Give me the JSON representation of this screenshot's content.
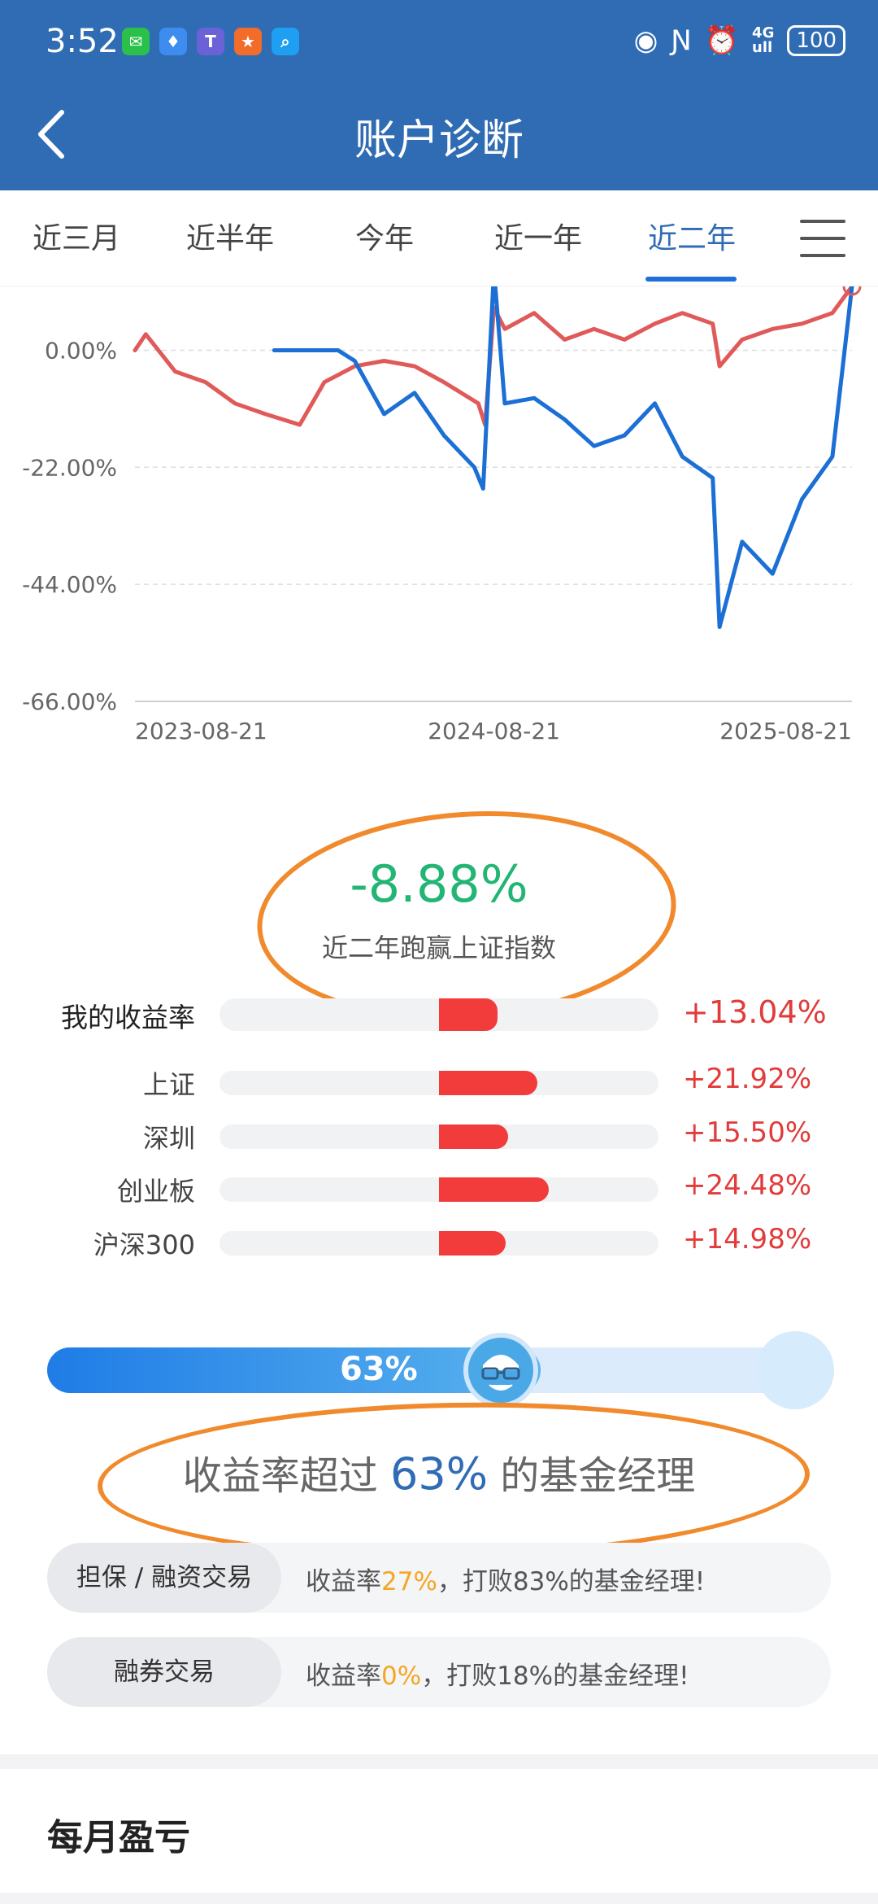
{
  "status": {
    "time": "3:52",
    "net_top": "4G",
    "net_bottom": "ull",
    "battery": "100"
  },
  "header": {
    "title": "账户诊断",
    "back_icon": "chevron-left-icon"
  },
  "tabs": [
    {
      "label": "近三月"
    },
    {
      "label": "近半年"
    },
    {
      "label": "今年"
    },
    {
      "label": "近一年"
    },
    {
      "label": "近二年",
      "active": true
    }
  ],
  "chart_data": {
    "type": "line",
    "y_ticks": [
      "0.00%",
      "-22.00%",
      "-44.00%",
      "-66.00%"
    ],
    "y_tick_values": [
      0,
      -22,
      -44,
      -66
    ],
    "ylim": [
      -66,
      12
    ],
    "x_ticks": [
      "2023-08-21",
      "2024-08-21",
      "2025-08-21"
    ],
    "x_range": [
      "2023-08-21",
      "2025-08-21"
    ],
    "grid": true,
    "series": [
      {
        "color": "#e05a5a",
        "x": [
          "2023-08-21",
          "2023-09-01",
          "2023-10-01",
          "2023-11-01",
          "2023-12-01",
          "2024-01-01",
          "2024-02-05",
          "2024-03-01",
          "2024-04-01",
          "2024-05-01",
          "2024-06-01",
          "2024-07-01",
          "2024-08-05",
          "2024-08-12",
          "2024-08-21",
          "2024-09-01",
          "2024-10-01",
          "2024-11-01",
          "2024-12-01",
          "2025-01-01",
          "2025-02-01",
          "2025-03-01",
          "2025-04-01",
          "2025-04-08",
          "2025-05-01",
          "2025-06-01",
          "2025-07-01",
          "2025-08-01",
          "2025-08-21"
        ],
        "values": [
          0,
          3,
          -4,
          -6,
          -10,
          -12,
          -14,
          -6,
          -3,
          -2,
          -3,
          -6,
          -10,
          -14,
          8,
          4,
          7,
          2,
          4,
          2,
          5,
          7,
          5,
          -3,
          2,
          4,
          5,
          7,
          12
        ]
      },
      {
        "color": "#1c6fd4",
        "x": [
          "2024-01-10",
          "2024-03-15",
          "2024-04-01",
          "2024-05-01",
          "2024-06-01",
          "2024-07-01",
          "2024-08-01",
          "2024-08-10",
          "2024-08-21",
          "2024-09-01",
          "2024-10-01",
          "2024-11-01",
          "2024-12-01",
          "2025-01-01",
          "2025-02-01",
          "2025-03-01",
          "2025-04-01",
          "2025-04-08",
          "2025-05-01",
          "2025-06-01",
          "2025-07-01",
          "2025-08-01",
          "2025-08-21"
        ],
        "values": [
          0,
          0,
          -2,
          -12,
          -8,
          -16,
          -22,
          -26,
          15,
          -10,
          -9,
          -13,
          -18,
          -16,
          -10,
          -20,
          -24,
          -52,
          -36,
          -42,
          -28,
          -20,
          12
        ]
      }
    ]
  },
  "summary": {
    "diff": "-8.88%",
    "label": "近二年跑赢上证指数"
  },
  "comparison": [
    {
      "label": "我的收益率",
      "value": "+13.04%",
      "pct": 13.04,
      "me": true
    },
    {
      "label": "上证",
      "value": "+21.92%",
      "pct": 21.92
    },
    {
      "label": "深圳",
      "value": "+15.50%",
      "pct": 15.5
    },
    {
      "label": "创业板",
      "value": "+24.48%",
      "pct": 24.48
    },
    {
      "label": "沪深300",
      "value": "+14.98%",
      "pct": 14.98
    }
  ],
  "percentile": {
    "value_text": "63%",
    "value": 0.63,
    "prefix": "收益率超过",
    "suffix": "的基金经理",
    "avatar_icon": "manager-glasses-icon"
  },
  "pills": [
    {
      "tag": "担保 / 融资交易",
      "text_a": "收益率",
      "rate": "27%",
      "text_b": "，打败83%的基金经理!"
    },
    {
      "tag": "融券交易",
      "text_a": "收益率",
      "rate": "0%",
      "text_b": "，打败18%的基金经理!"
    }
  ],
  "monthly": {
    "title": "每月盈亏"
  },
  "colors": {
    "header_bg": "#2f6cb4",
    "positive": "#e23b3b",
    "diff_green": "#22b573",
    "accent": "#1e6fd9",
    "annotation": "#f08a2c"
  }
}
